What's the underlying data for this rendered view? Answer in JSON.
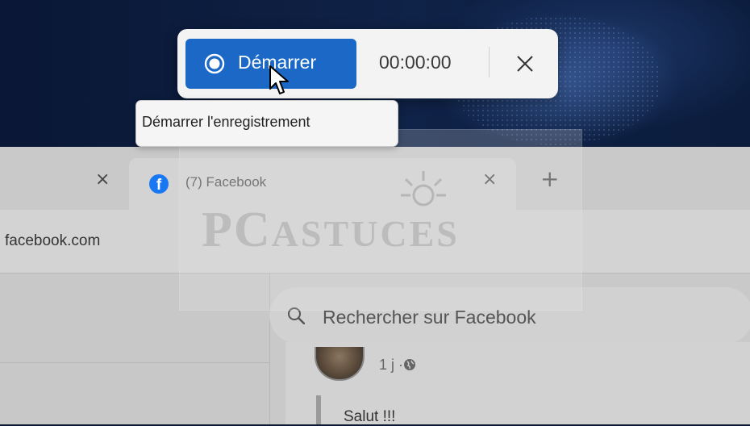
{
  "recorder": {
    "start_label": "Démarrer",
    "timer": "00:00:00",
    "tooltip": "Démarrer l'enregistrement",
    "accent_color": "#1b68c6"
  },
  "browser": {
    "prev_tab_close": "×",
    "active_tab": {
      "title": "(7) Facebook",
      "favicon": "f",
      "close": "×"
    },
    "new_tab": "+",
    "url": "facebook.com"
  },
  "page": {
    "search_placeholder": "Rechercher sur Facebook",
    "post_meta": "1 j ·",
    "post_text": "Salut !!!"
  },
  "watermark": "PC ASTUCES",
  "icons": [
    "record-icon",
    "close-icon",
    "facebook-icon",
    "search-icon",
    "globe-icon",
    "mouse-cursor-icon",
    "lightbulb-icon"
  ]
}
